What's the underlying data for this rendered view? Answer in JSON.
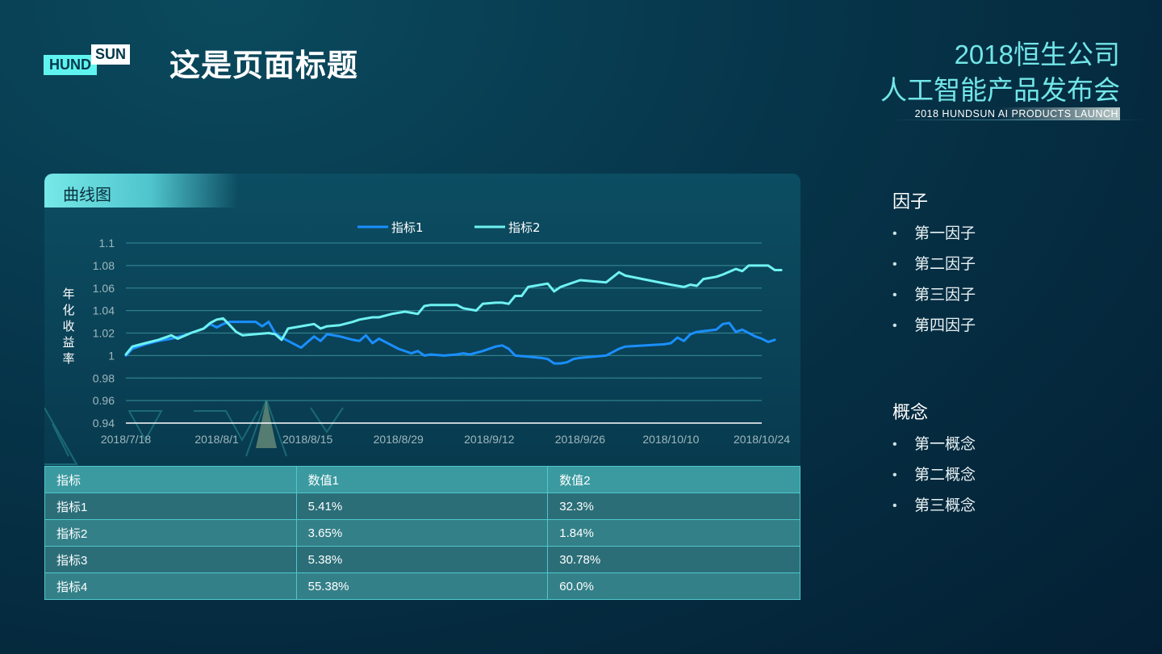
{
  "logo": {
    "left": "HUND",
    "right": "SUN"
  },
  "header": {
    "page_title": "这是页面标题",
    "event_line1": "2018恒生公司",
    "event_line2": "人工智能产品发布会",
    "event_sub": "2018 HUNDSUN  AI  PRODUCTS  LAUNCH"
  },
  "panel": {
    "tab_label": "曲线图"
  },
  "colors": {
    "series1": "#1a8fff",
    "series2": "#6ff2f2",
    "accent": "#72e6e8"
  },
  "chart_data": {
    "type": "line",
    "title": "",
    "xlabel": "",
    "ylabel": "年化收益率",
    "ylim": [
      0.94,
      1.1
    ],
    "yticks": [
      "1.1",
      "1.08",
      "1.06",
      "1.04",
      "1.02",
      "1",
      "0.98",
      "0.96",
      "0.94"
    ],
    "xticks": [
      "2018/7/18",
      "2018/8/1",
      "2018/8/15",
      "2018/8/29",
      "2018/9/12",
      "2018/9/26",
      "2018/10/10",
      "2018/10/24"
    ],
    "legend_position": "top-center",
    "grid": true,
    "x_start": "2018/7/18",
    "x_end": "2018/10/24",
    "series": [
      {
        "name": "指标1",
        "points": [
          [
            "2018/7/18",
            1.0
          ],
          [
            "2018/7/19",
            1.006
          ],
          [
            "2018/7/21",
            1.01
          ],
          [
            "2018/7/23",
            1.013
          ],
          [
            "2018/7/25",
            1.015
          ],
          [
            "2018/7/27",
            1.018
          ],
          [
            "2018/7/28",
            1.02
          ],
          [
            "2018/7/30",
            1.024
          ],
          [
            "2018/7/31",
            1.028
          ],
          [
            "2018/8/1",
            1.025
          ],
          [
            "2018/8/2",
            1.028
          ],
          [
            "2018/8/3",
            1.03
          ],
          [
            "2018/8/5",
            1.03
          ],
          [
            "2018/8/7",
            1.03
          ],
          [
            "2018/8/8",
            1.026
          ],
          [
            "2018/8/9",
            1.03
          ],
          [
            "2018/8/10",
            1.02
          ],
          [
            "2018/8/11",
            1.016
          ],
          [
            "2018/8/13",
            1.01
          ],
          [
            "2018/8/14",
            1.007
          ],
          [
            "2018/8/16",
            1.017
          ],
          [
            "2018/8/17",
            1.013
          ],
          [
            "2018/8/18",
            1.019
          ],
          [
            "2018/8/20",
            1.017
          ],
          [
            "2018/8/22",
            1.014
          ],
          [
            "2018/8/23",
            1.013
          ],
          [
            "2018/8/24",
            1.018
          ],
          [
            "2018/8/25",
            1.011
          ],
          [
            "2018/8/26",
            1.015
          ],
          [
            "2018/8/27",
            1.012
          ],
          [
            "2018/8/29",
            1.006
          ],
          [
            "2018/8/31",
            1.002
          ],
          [
            "2018/9/1",
            1.004
          ],
          [
            "2018/9/2",
            1.0
          ],
          [
            "2018/9/3",
            1.001
          ],
          [
            "2018/9/5",
            1.0
          ],
          [
            "2018/9/7",
            1.001
          ],
          [
            "2018/9/8",
            1.002
          ],
          [
            "2018/9/9",
            1.001
          ],
          [
            "2018/9/11",
            1.004
          ],
          [
            "2018/9/13",
            1.008
          ],
          [
            "2018/9/14",
            1.009
          ],
          [
            "2018/9/15",
            1.006
          ],
          [
            "2018/9/16",
            1.0
          ],
          [
            "2018/9/18",
            0.999
          ],
          [
            "2018/9/20",
            0.998
          ],
          [
            "2018/9/21",
            0.997
          ],
          [
            "2018/9/22",
            0.993
          ],
          [
            "2018/9/23",
            0.993
          ],
          [
            "2018/9/24",
            0.994
          ],
          [
            "2018/9/25",
            0.997
          ],
          [
            "2018/9/26",
            0.998
          ],
          [
            "2018/9/28",
            0.999
          ],
          [
            "2018/9/30",
            1.0
          ],
          [
            "2018/10/1",
            1.003
          ],
          [
            "2018/10/2",
            1.006
          ],
          [
            "2018/10/3",
            1.008
          ],
          [
            "2018/10/9",
            1.01
          ],
          [
            "2018/10/10",
            1.011
          ],
          [
            "2018/10/11",
            1.016
          ],
          [
            "2018/10/12",
            1.013
          ],
          [
            "2018/10/13",
            1.019
          ],
          [
            "2018/10/14",
            1.021
          ],
          [
            "2018/10/17",
            1.023
          ],
          [
            "2018/10/18",
            1.028
          ],
          [
            "2018/10/19",
            1.029
          ],
          [
            "2018/10/20",
            1.021
          ],
          [
            "2018/10/21",
            1.023
          ],
          [
            "2018/10/23",
            1.017
          ],
          [
            "2018/10/24",
            1.015
          ],
          [
            "2018/10/25",
            1.012
          ],
          [
            "2018/10/26",
            1.014
          ]
        ]
      },
      {
        "name": "指标2",
        "points": [
          [
            "2018/7/18",
            1.001
          ],
          [
            "2018/7/19",
            1.008
          ],
          [
            "2018/7/21",
            1.011
          ],
          [
            "2018/7/23",
            1.014
          ],
          [
            "2018/7/25",
            1.018
          ],
          [
            "2018/7/26",
            1.015
          ],
          [
            "2018/7/28",
            1.02
          ],
          [
            "2018/7/30",
            1.024
          ],
          [
            "2018/7/31",
            1.029
          ],
          [
            "2018/8/1",
            1.032
          ],
          [
            "2018/8/2",
            1.033
          ],
          [
            "2018/8/3",
            1.027
          ],
          [
            "2018/8/4",
            1.021
          ],
          [
            "2018/8/5",
            1.018
          ],
          [
            "2018/8/7",
            1.019
          ],
          [
            "2018/8/9",
            1.02
          ],
          [
            "2018/8/10",
            1.019
          ],
          [
            "2018/8/11",
            1.014
          ],
          [
            "2018/8/12",
            1.024
          ],
          [
            "2018/8/14",
            1.026
          ],
          [
            "2018/8/16",
            1.028
          ],
          [
            "2018/8/17",
            1.024
          ],
          [
            "2018/8/18",
            1.026
          ],
          [
            "2018/8/20",
            1.027
          ],
          [
            "2018/8/22",
            1.03
          ],
          [
            "2018/8/23",
            1.032
          ],
          [
            "2018/8/25",
            1.034
          ],
          [
            "2018/8/26",
            1.034
          ],
          [
            "2018/8/28",
            1.037
          ],
          [
            "2018/8/30",
            1.039
          ],
          [
            "2018/9/1",
            1.037
          ],
          [
            "2018/9/2",
            1.044
          ],
          [
            "2018/9/3",
            1.045
          ],
          [
            "2018/9/5",
            1.045
          ],
          [
            "2018/9/6",
            1.045
          ],
          [
            "2018/9/7",
            1.045
          ],
          [
            "2018/9/8",
            1.042
          ],
          [
            "2018/9/10",
            1.04
          ],
          [
            "2018/9/11",
            1.046
          ],
          [
            "2018/9/13",
            1.047
          ],
          [
            "2018/9/14",
            1.047
          ],
          [
            "2018/9/15",
            1.046
          ],
          [
            "2018/9/16",
            1.053
          ],
          [
            "2018/9/17",
            1.053
          ],
          [
            "2018/9/18",
            1.061
          ],
          [
            "2018/9/20",
            1.063
          ],
          [
            "2018/9/21",
            1.064
          ],
          [
            "2018/9/22",
            1.057
          ],
          [
            "2018/9/23",
            1.061
          ],
          [
            "2018/9/24",
            1.063
          ],
          [
            "2018/9/26",
            1.067
          ],
          [
            "2018/9/28",
            1.066
          ],
          [
            "2018/9/30",
            1.065
          ],
          [
            "2018/10/2",
            1.074
          ],
          [
            "2018/10/3",
            1.071
          ],
          [
            "2018/10/10",
            1.063
          ],
          [
            "2018/10/12",
            1.061
          ],
          [
            "2018/10/13",
            1.063
          ],
          [
            "2018/10/14",
            1.062
          ],
          [
            "2018/10/15",
            1.068
          ],
          [
            "2018/10/17",
            1.07
          ],
          [
            "2018/10/18",
            1.072
          ],
          [
            "2018/10/20",
            1.077
          ],
          [
            "2018/10/21",
            1.075
          ],
          [
            "2018/10/22",
            1.08
          ],
          [
            "2018/10/24",
            1.08
          ],
          [
            "2018/10/25",
            1.08
          ],
          [
            "2018/10/26",
            1.076
          ],
          [
            "2018/10/27",
            1.076
          ]
        ]
      }
    ]
  },
  "table": {
    "headers": [
      "指标",
      "数值1",
      "数值2"
    ],
    "rows": [
      [
        "指标1",
        "5.41%",
        "32.3%"
      ],
      [
        "指标2",
        "3.65%",
        "1.84%"
      ],
      [
        "指标3",
        "5.38%",
        "30.78%"
      ],
      [
        "指标4",
        "55.38%",
        "60.0%"
      ]
    ]
  },
  "factors": {
    "title": "因子",
    "items": [
      "第一因子",
      "第二因子",
      "第三因子",
      "第四因子"
    ]
  },
  "concepts": {
    "title": "概念",
    "items": [
      "第一概念",
      "第二概念",
      "第三概念"
    ]
  }
}
